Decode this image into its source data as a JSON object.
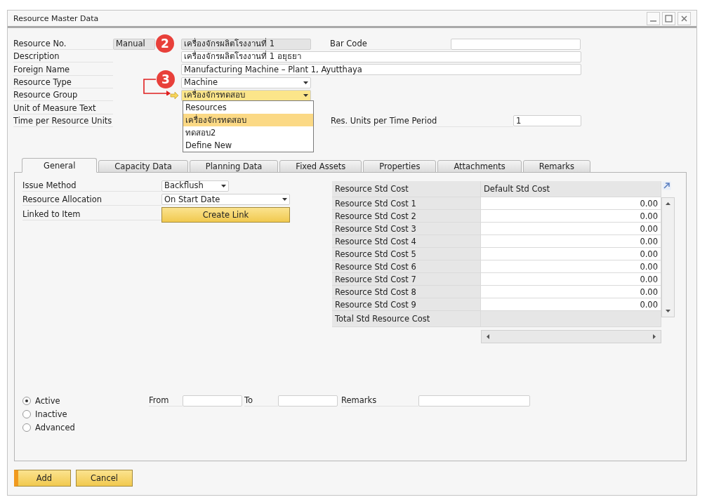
{
  "window": {
    "title": "Resource Master Data"
  },
  "header": {
    "rows": [
      {
        "kind": "resource_no",
        "label": "Resource No.",
        "series": "Manual",
        "value": "เครื่องจักรผลิตโรงงานที่ 1",
        "side_label": "Bar Code",
        "side_value": ""
      },
      {
        "kind": "text",
        "label": "Description",
        "value": "เครื่องจักรผลิตโรงงานที่ 1 อยุธยา"
      },
      {
        "kind": "text",
        "label": "Foreign Name",
        "value": "Manufacturing Machine – Plant 1, Ayutthaya"
      },
      {
        "kind": "select",
        "label": "Resource Type",
        "value": "Machine",
        "highlighted": false
      },
      {
        "kind": "select",
        "label": "Resource Group",
        "value": "เครื่องจักรทดสอบ",
        "highlighted": true,
        "open": true,
        "options": [
          {
            "label": "Resources",
            "selected": false
          },
          {
            "label": "เครื่องจักรทดสอบ",
            "selected": true
          },
          {
            "label": "ทดสอบ2",
            "selected": false
          },
          {
            "label": "Define New",
            "selected": false
          }
        ]
      },
      {
        "kind": "label",
        "label": "Unit of Measure Text"
      },
      {
        "kind": "side",
        "label": "Time per Resource Units",
        "side_label": "Res. Units per Time Period",
        "side_value": "1"
      }
    ]
  },
  "callouts": [
    {
      "label": "2"
    },
    {
      "label": "3"
    }
  ],
  "tabs": [
    {
      "label": "General",
      "selected": true
    },
    {
      "label": "Capacity Data",
      "selected": false
    },
    {
      "label": "Planning Data",
      "selected": false
    },
    {
      "label": "Fixed Assets",
      "selected": false
    },
    {
      "label": "Properties",
      "selected": false
    },
    {
      "label": "Attachments",
      "selected": false
    },
    {
      "label": "Remarks",
      "selected": false
    }
  ],
  "general": {
    "fields": [
      {
        "kind": "select",
        "label": "Issue Method",
        "value": "Backflush",
        "wide": false
      },
      {
        "kind": "select",
        "label": "Resource Allocation",
        "value": "On Start Date",
        "wide": true
      },
      {
        "kind": "button",
        "label": "Linked to Item",
        "value": "Create Link"
      }
    ]
  },
  "cost_table": {
    "columns": [
      "Resource Std Cost",
      "Default Std Cost"
    ],
    "rows": [
      {
        "name": "Resource Std Cost 1",
        "value": "0.00"
      },
      {
        "name": "Resource Std Cost 2",
        "value": "0.00"
      },
      {
        "name": "Resource Std Cost 3",
        "value": "0.00"
      },
      {
        "name": "Resource Std Cost 4",
        "value": "0.00"
      },
      {
        "name": "Resource Std Cost 5",
        "value": "0.00"
      },
      {
        "name": "Resource Std Cost 6",
        "value": "0.00"
      },
      {
        "name": "Resource Std Cost 7",
        "value": "0.00"
      },
      {
        "name": "Resource Std Cost 8",
        "value": "0.00"
      },
      {
        "name": "Resource Std Cost 9",
        "value": "0.00"
      }
    ],
    "total": {
      "name": "Total Std Resource Cost"
    }
  },
  "status": {
    "options": [
      {
        "label": "Active",
        "selected": true
      },
      {
        "label": "Inactive",
        "selected": false
      },
      {
        "label": "Advanced",
        "selected": false
      }
    ],
    "from": {
      "label": "From"
    },
    "to": {
      "label": "To"
    },
    "remarks": {
      "label": "Remarks"
    }
  },
  "buttons": [
    {
      "label": "Add",
      "primary": true
    },
    {
      "label": "Cancel",
      "primary": false
    }
  ]
}
